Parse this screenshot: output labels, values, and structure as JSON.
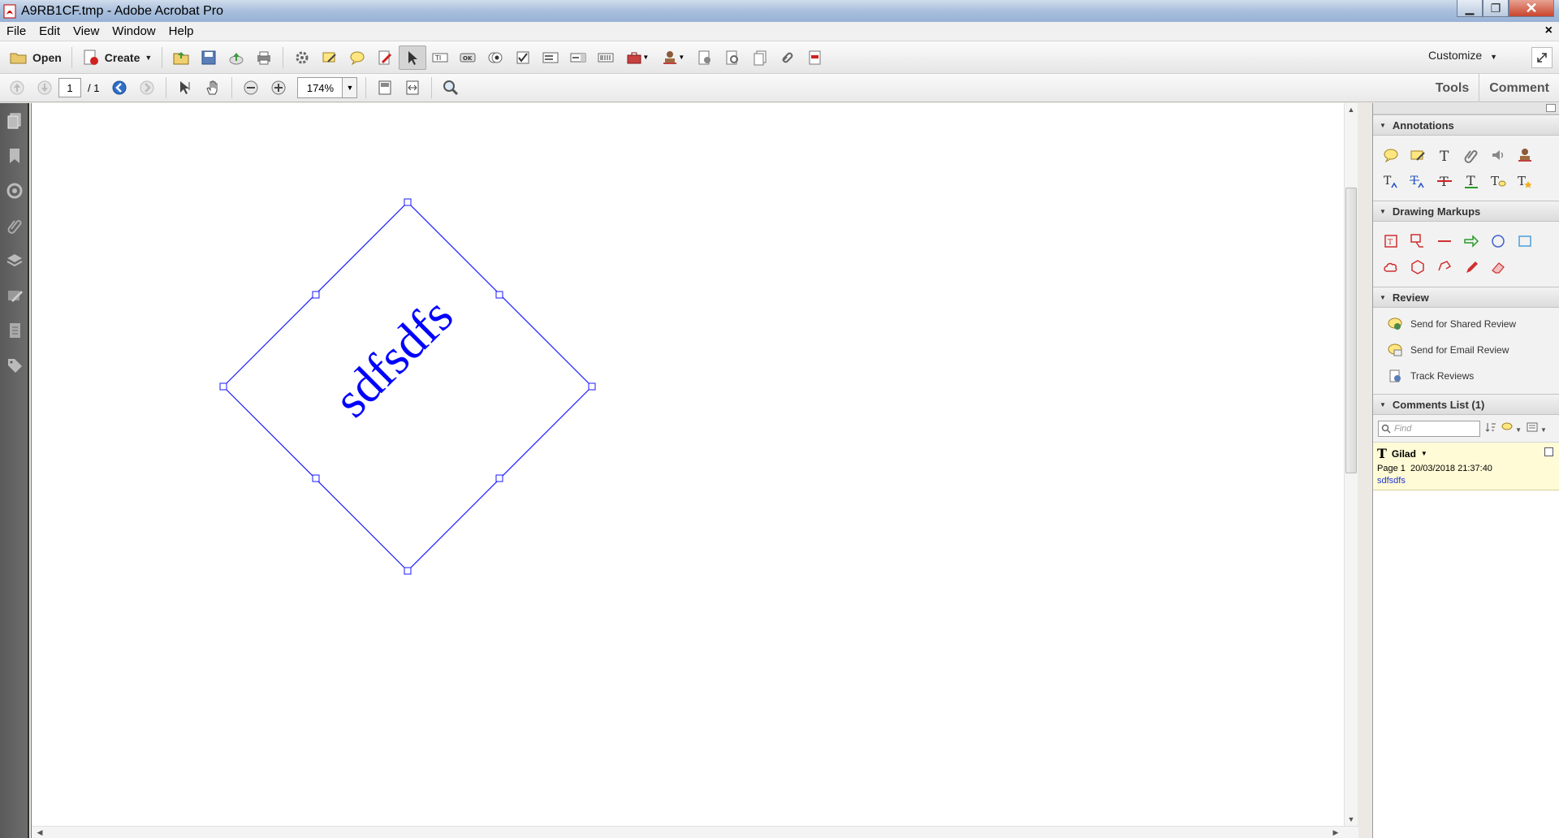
{
  "window": {
    "title": "A9RB1CF.tmp - Adobe Acrobat Pro"
  },
  "menu": {
    "items": [
      "File",
      "Edit",
      "View",
      "Window",
      "Help"
    ],
    "close_glyph": "×"
  },
  "toolbar": {
    "open_label": "Open",
    "create_label": "Create",
    "customize_label": "Customize"
  },
  "nav": {
    "page_current": "1",
    "page_total": "/ 1",
    "zoom": "174%",
    "tools_tab": "Tools",
    "comment_tab": "Comment"
  },
  "document": {
    "annotation_text": "sdfsdfs",
    "annotation_color": "#0000ff",
    "annotation_rotation_deg": -45
  },
  "panel": {
    "annotations_title": "Annotations",
    "drawing_title": "Drawing Markups",
    "review_title": "Review",
    "review_items": [
      "Send for Shared Review",
      "Send for Email Review",
      "Track Reviews"
    ],
    "comments_title": "Comments List (1)",
    "find_placeholder": "Find",
    "comment": {
      "author": "Gilad",
      "page": "Page 1",
      "timestamp": "20/03/2018 21:37:40",
      "text": "sdfsdfs"
    }
  },
  "icons": {
    "annotations": [
      "sticky-note-icon",
      "highlight-text-icon",
      "add-text-icon",
      "attach-file-icon",
      "record-audio-icon",
      "stamp-icon",
      "insert-text-icon",
      "replace-text-icon",
      "strikethrough-icon",
      "underline-icon",
      "add-note-to-text-icon",
      "text-correction-icon"
    ],
    "drawing": [
      "text-box-icon",
      "callout-icon",
      "line-icon",
      "arrow-icon",
      "oval-icon",
      "rectangle-icon",
      "cloud-icon",
      "polygon-icon",
      "connected-lines-icon",
      "pencil-icon",
      "eraser-icon"
    ]
  }
}
